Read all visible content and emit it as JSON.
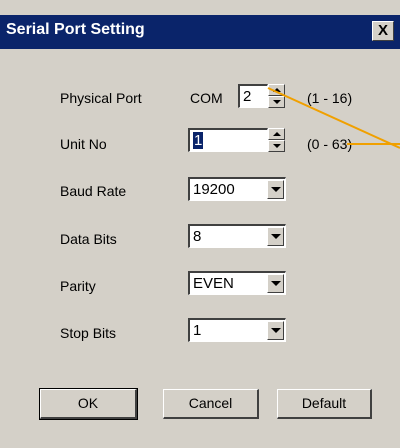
{
  "window": {
    "title": "Serial Port Setting",
    "close_label": "X"
  },
  "physical_port": {
    "label": "Physical Port",
    "prefix": "COM",
    "value": "2",
    "range": "(1 - 16)"
  },
  "unit_no": {
    "label": "Unit No",
    "value": "1",
    "range": "(0 - 63)"
  },
  "baud_rate": {
    "label": "Baud Rate",
    "value": "19200"
  },
  "data_bits": {
    "label": "Data Bits",
    "value": "8"
  },
  "parity": {
    "label": "Parity",
    "value": "EVEN"
  },
  "stop_bits": {
    "label": "Stop Bits",
    "value": "1"
  },
  "buttons": {
    "ok": "OK",
    "cancel": "Cancel",
    "default": "Default"
  },
  "colors": {
    "titlebar": "#0a246a",
    "dialog_bg": "#d4d0c8",
    "callout_line": "#f0a000"
  }
}
